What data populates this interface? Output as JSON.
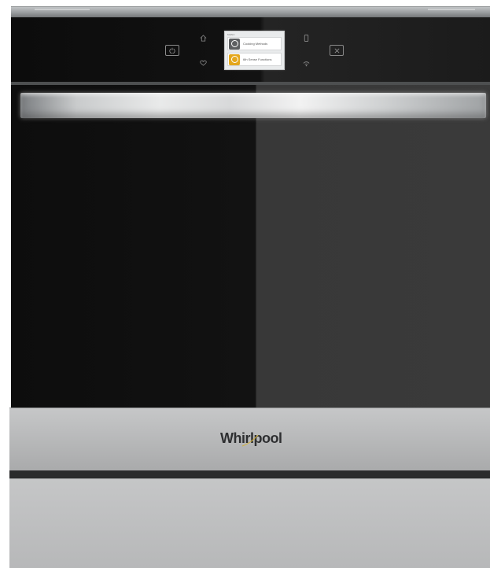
{
  "display": {
    "header": "MENU",
    "items": [
      {
        "label": "Cooking Methods",
        "icon": "cooking-methods-icon",
        "color": "#5d5f61"
      },
      {
        "label": "6th Sense Functions",
        "icon": "sixth-sense-icon",
        "color": "#e4a71c"
      }
    ]
  },
  "controls": {
    "icons": [
      "power-icon",
      "home-icon",
      "favorite-heart-icon",
      "phone-icon",
      "wifi-connect-icon",
      "cancel-icon"
    ]
  },
  "brand": {
    "name": "Whirlpool"
  }
}
